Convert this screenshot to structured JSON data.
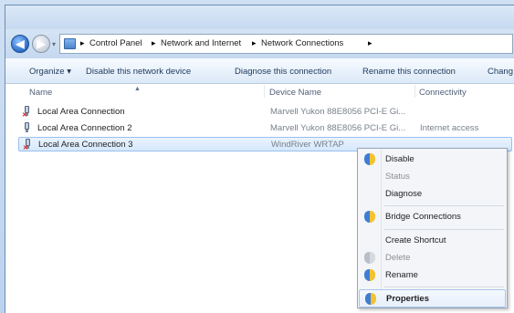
{
  "address": {
    "breadcrumbs": [
      "Control Panel",
      "Network and Internet",
      "Network Connections"
    ],
    "separator_glyph": "▸"
  },
  "toolbar": {
    "buttons": [
      "Organize",
      "Disable this network device",
      "Diagnose this connection",
      "Rename this connection",
      "Chang"
    ],
    "organize_dropdown_glyph": "▾"
  },
  "columns": {
    "name": "Name",
    "device": "Device Name",
    "connectivity": "Connectivity"
  },
  "connections": [
    {
      "name": "Local Area Connection",
      "device": "Marvell Yukon 88E8056 PCI-E Gi...",
      "connectivity": "",
      "status_icon": "disconnected-x"
    },
    {
      "name": "Local Area Connection 2",
      "device": "Marvell Yukon 88E8056 PCI-E Gi...",
      "connectivity": "Internet access",
      "status_icon": "connected"
    },
    {
      "name": "Local Area Connection 3",
      "device": "WindRiver WRTAP",
      "connectivity": "",
      "status_icon": "disconnected-x",
      "selected": true
    }
  ],
  "context_menu": {
    "items": [
      {
        "label": "Disable",
        "icon": "shield-icon",
        "enabled": true
      },
      {
        "label": "Status",
        "icon": "",
        "enabled": false
      },
      {
        "label": "Diagnose",
        "icon": "",
        "enabled": true
      },
      {
        "label": "Bridge Connections",
        "icon": "shield-icon",
        "enabled": true
      },
      {
        "label": "Create Shortcut",
        "icon": "",
        "enabled": true
      },
      {
        "label": "Delete",
        "icon": "shield-icon",
        "enabled": false
      },
      {
        "label": "Rename",
        "icon": "shield-icon",
        "enabled": true
      },
      {
        "label": "Properties",
        "icon": "shield-icon",
        "enabled": true,
        "bold": true,
        "highlighted": true
      }
    ]
  },
  "colors": {
    "selection_fill": "#d6e8fd",
    "selection_border": "#99c0ef",
    "shield_blue": "#3f7dd4",
    "shield_gold": "#f3c230"
  }
}
